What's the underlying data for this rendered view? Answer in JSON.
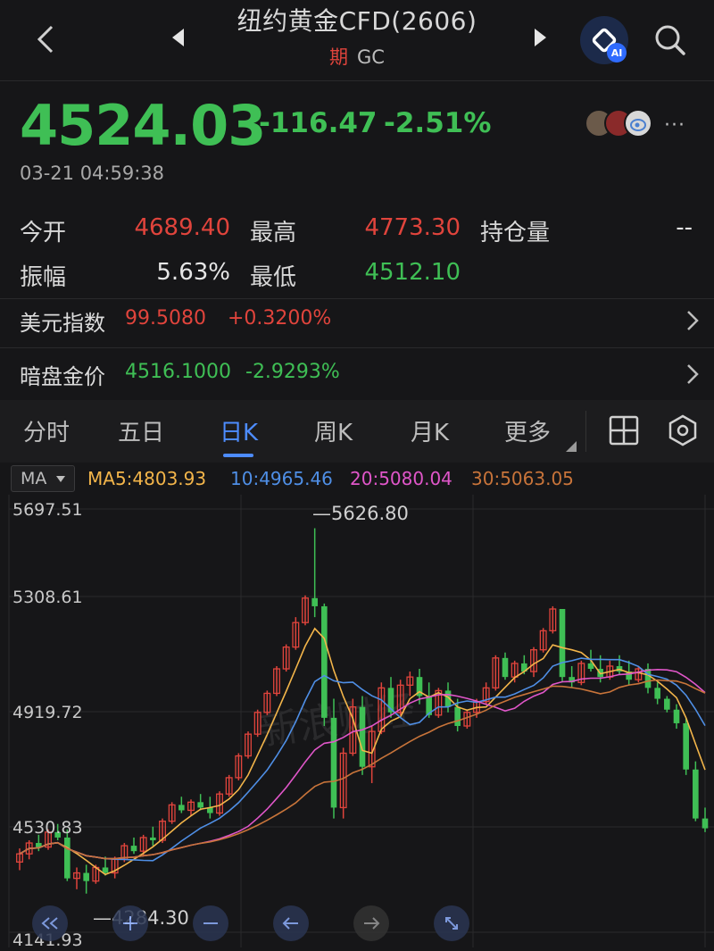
{
  "header": {
    "title": "纽约黄金CFD(2606)",
    "tag": "期",
    "code": "GC",
    "ai_label": "AI"
  },
  "quote": {
    "price": "4524.03",
    "change": "-116.47",
    "change_pct": "-2.51%",
    "timestamp": "03-21 04:59:38",
    "more": "···"
  },
  "stats": {
    "open_label": "今开",
    "open": "4689.40",
    "high_label": "最高",
    "high": "4773.30",
    "oi_label": "持仓量",
    "oi": "--",
    "amp_label": "振幅",
    "amp": "5.63%",
    "low_label": "最低",
    "low": "4512.10"
  },
  "related": [
    {
      "label": "美元指数",
      "value": "99.5080",
      "change": "+0.3200%",
      "color": "#e0443c"
    },
    {
      "label": "暗盘金价",
      "value": "4516.1000",
      "change": "-2.9293%",
      "color": "#3fbf55"
    }
  ],
  "tabs": [
    "分时",
    "五日",
    "日K",
    "周K",
    "月K",
    "更多"
  ],
  "active_tab": "日K",
  "ma": {
    "selector": "MA",
    "ma5": "MA5:4803.93",
    "ma10": "10:4965.46",
    "ma20": "20:5080.04",
    "ma30": "30:5063.05",
    "colors": {
      "ma5": "#f3b54a",
      "ma10": "#4f8fe6",
      "ma20": "#e056c9",
      "ma30": "#c8743a"
    }
  },
  "chart_data": {
    "type": "candlestick",
    "y_labels": [
      "5697.51",
      "5308.61",
      "4919.72",
      "4530.83",
      "4141.93"
    ],
    "high_annotation": "5626.80",
    "low_annotation": "4284.30",
    "ylim": [
      4141.93,
      5697.51
    ],
    "up_color": "#e0443c",
    "down_color": "#3fbf55"
  },
  "watermark": "新浪财经"
}
